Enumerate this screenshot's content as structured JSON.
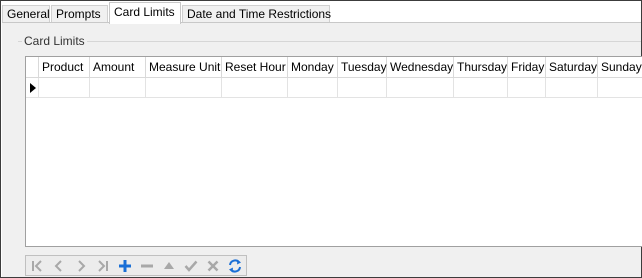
{
  "tabs": [
    {
      "label": "General"
    },
    {
      "label": "Prompts"
    },
    {
      "label": "Card Limits",
      "active": true
    },
    {
      "label": "Date and Time Restrictions"
    }
  ],
  "group": {
    "title": "Card Limits"
  },
  "grid": {
    "columns": [
      "Product",
      "Amount",
      "Measure Unit",
      "Reset Hour",
      "Monday",
      "Tuesday",
      "Wednesday",
      "Thursday",
      "Friday",
      "Saturday",
      "Sunday"
    ],
    "rows": [
      {
        "current": true,
        "cells": [
          "",
          "",
          "",
          "",
          "",
          "",
          "",
          "",
          "",
          "",
          ""
        ]
      }
    ]
  },
  "navigator": {
    "buttons": [
      {
        "icon": "first-record-icon",
        "enabled": false
      },
      {
        "icon": "prior-record-icon",
        "enabled": false
      },
      {
        "icon": "next-record-icon",
        "enabled": false
      },
      {
        "icon": "last-record-icon",
        "enabled": false
      },
      {
        "icon": "insert-record-icon",
        "enabled": true
      },
      {
        "icon": "delete-record-icon",
        "enabled": false
      },
      {
        "icon": "edit-record-icon",
        "enabled": false
      },
      {
        "icon": "post-record-icon",
        "enabled": false
      },
      {
        "icon": "cancel-edit-icon",
        "enabled": false
      },
      {
        "icon": "refresh-icon",
        "enabled": true
      }
    ]
  },
  "colors": {
    "disabled_icon": "#a8a8a8",
    "accent_blue": "#1a6fd6"
  }
}
